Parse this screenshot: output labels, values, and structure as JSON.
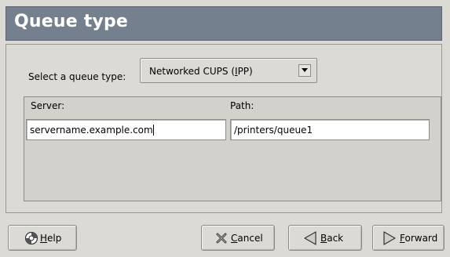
{
  "header": {
    "title": "Queue type"
  },
  "queue_type": {
    "label": "Select a queue type:",
    "selected": "Networked CUPS (IPP)",
    "selected_pre": "Networked CUPS (",
    "selected_mnemonic": "I",
    "selected_post": "PP)"
  },
  "server": {
    "label": "Server:",
    "value": "servername.example.com"
  },
  "path": {
    "label": "Path:",
    "value": "/printers/queue1"
  },
  "buttons": {
    "help": {
      "label": "Help",
      "mnemonic": "H",
      "rest": "elp",
      "icon": "help-icon"
    },
    "cancel": {
      "label": "Cancel",
      "mnemonic": "C",
      "rest": "ancel",
      "icon": "cancel-x-icon"
    },
    "back": {
      "label": "Back",
      "mnemonic": "B",
      "rest": "ack",
      "icon": "back-arrow-icon"
    },
    "forward": {
      "label": "Forward",
      "mnemonic": "F",
      "rest": "orward",
      "icon": "forward-arrow-icon"
    }
  },
  "colors": {
    "header_bg": "#75808f",
    "window_bg": "#dcdad5",
    "panel_bg": "#d3d1cc"
  }
}
